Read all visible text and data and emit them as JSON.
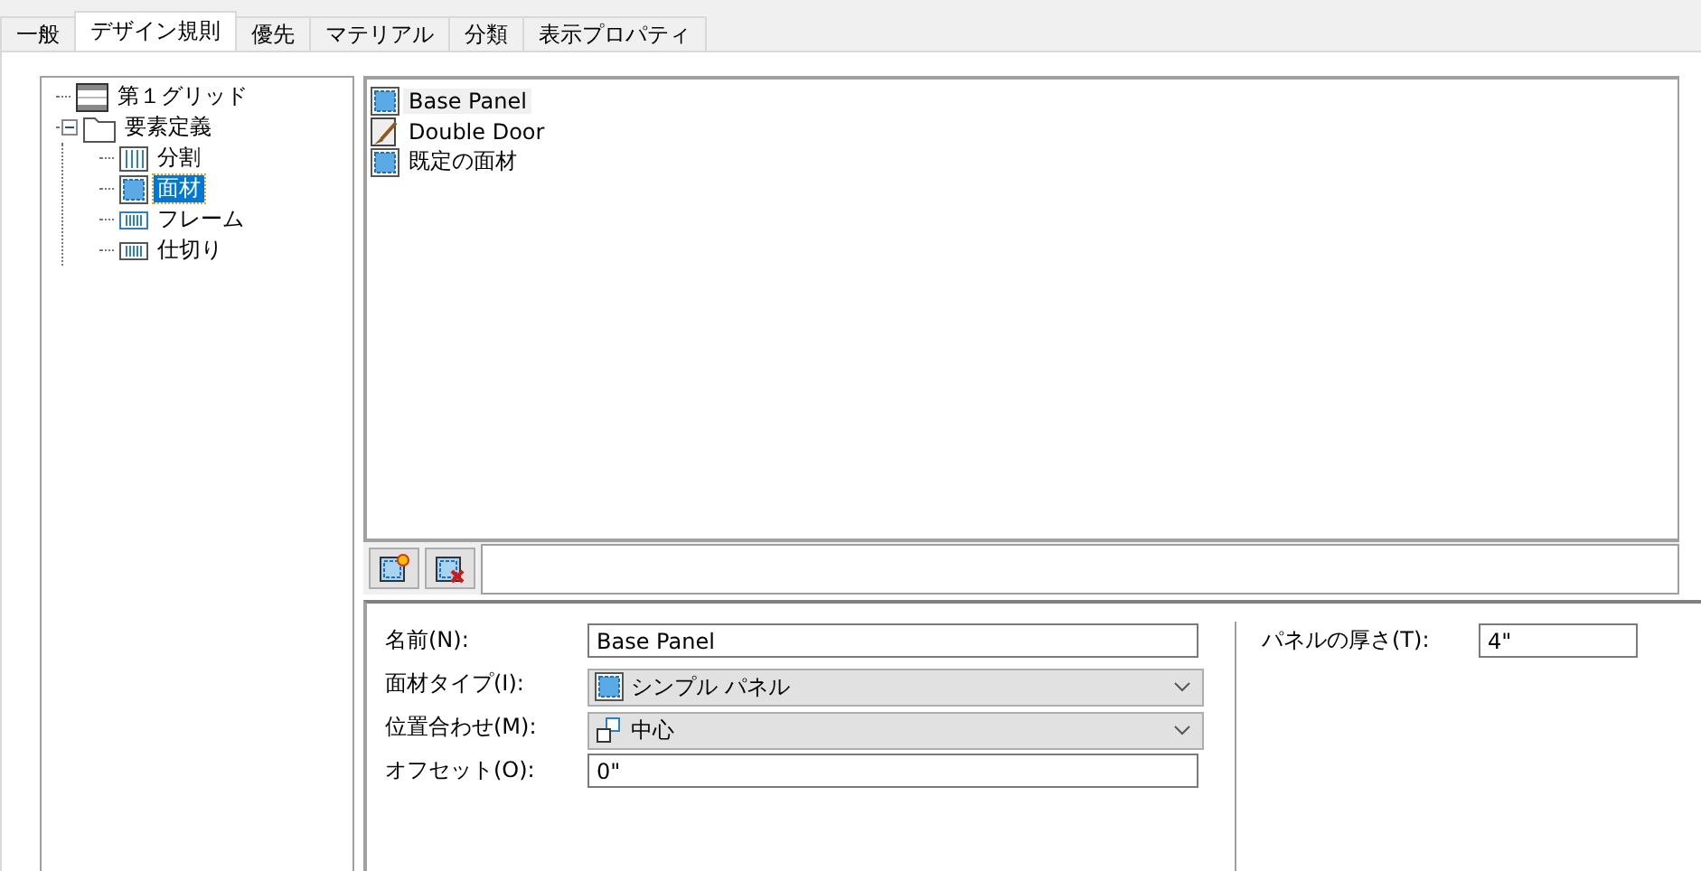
{
  "tabs": [
    {
      "label": "一般",
      "selected": false
    },
    {
      "label": "デザイン規則",
      "selected": true
    },
    {
      "label": "優先",
      "selected": false
    },
    {
      "label": "マテリアル",
      "selected": false
    },
    {
      "label": "分類",
      "selected": false
    },
    {
      "label": "表示プロパティ",
      "selected": false
    }
  ],
  "tree": [
    {
      "label": "第１グリッド",
      "kind": "grid",
      "selected": false
    },
    {
      "label": "要素定義",
      "kind": "folder",
      "expanded": true,
      "selected": false,
      "children": [
        {
          "label": "分割",
          "kind": "division",
          "selected": false
        },
        {
          "label": "面材",
          "kind": "panel",
          "selected": true
        },
        {
          "label": "フレーム",
          "kind": "frame",
          "selected": false
        },
        {
          "label": "仕切り",
          "kind": "mullion",
          "selected": false
        }
      ]
    }
  ],
  "list": [
    {
      "label": "Base Panel",
      "kind": "panel",
      "selected": true
    },
    {
      "label": "Double Door",
      "kind": "door",
      "selected": false
    },
    {
      "label": "既定の面材",
      "kind": "panel",
      "selected": false
    }
  ],
  "properties": [
    {
      "label": "名前(N):",
      "kind": "text",
      "value": "Base Panel"
    },
    {
      "label": "面材タイプ(I):",
      "kind": "typeselect",
      "value": "シンプル パネル"
    },
    {
      "label": "位置合わせ(M):",
      "kind": "alignselect",
      "value": "中心"
    },
    {
      "label": "オフセット(O):",
      "kind": "text",
      "value": "0\""
    }
  ],
  "side_property": {
    "label": "パネルの厚さ(T):",
    "value": "4\""
  }
}
